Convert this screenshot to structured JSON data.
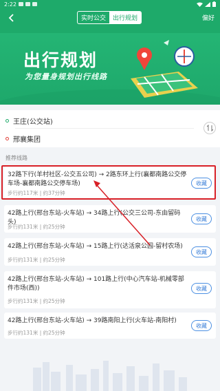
{
  "status": {
    "time": "2:22"
  },
  "nav": {
    "tabs": [
      {
        "label": "实时公交"
      },
      {
        "label": "出行规划"
      }
    ],
    "settings": "偏好"
  },
  "banner": {
    "title": "出行规划",
    "subtitle": "为您量身规划出行线路"
  },
  "route": {
    "from": "王庄(公交站)",
    "to": "邢襄集团"
  },
  "recommend": {
    "label": "推荐线路",
    "plans": [
      {
        "line": "32路下行(羊村社区-公交五公司) → 2路东环上行(襄都南路公交停车场-襄都南路公交停车场)",
        "meta": "步行约117米 | 约37分钟",
        "btn": "收藏"
      },
      {
        "line": "42路上行(邢台东站-火车站) → 34路上行(公交三公司-东由留码头)",
        "meta": "步行约131米 | 约25分钟",
        "btn": "收藏"
      },
      {
        "line": "42路上行(邢台东站-火车站) → 15路上行(达活泉公园-留村农场)",
        "meta": "步行约131米 | 约25分钟",
        "btn": "收藏"
      },
      {
        "line": "42路上行(邢台东站-火车站) → 101路上行(中心汽车站-机械零部件市场(西))",
        "meta": "步行约131米 | 约25分钟",
        "btn": "收藏"
      },
      {
        "line": "42路上行(邢台东站-火车站) → 39路南阳上行(火车站-南阳村)",
        "meta": "步行约131米 | 约25分钟",
        "btn": "收藏"
      }
    ]
  },
  "colors": {
    "primary": "#1eaa6a",
    "accent_blue": "#3a7fd8",
    "highlight": "#d81f26"
  }
}
